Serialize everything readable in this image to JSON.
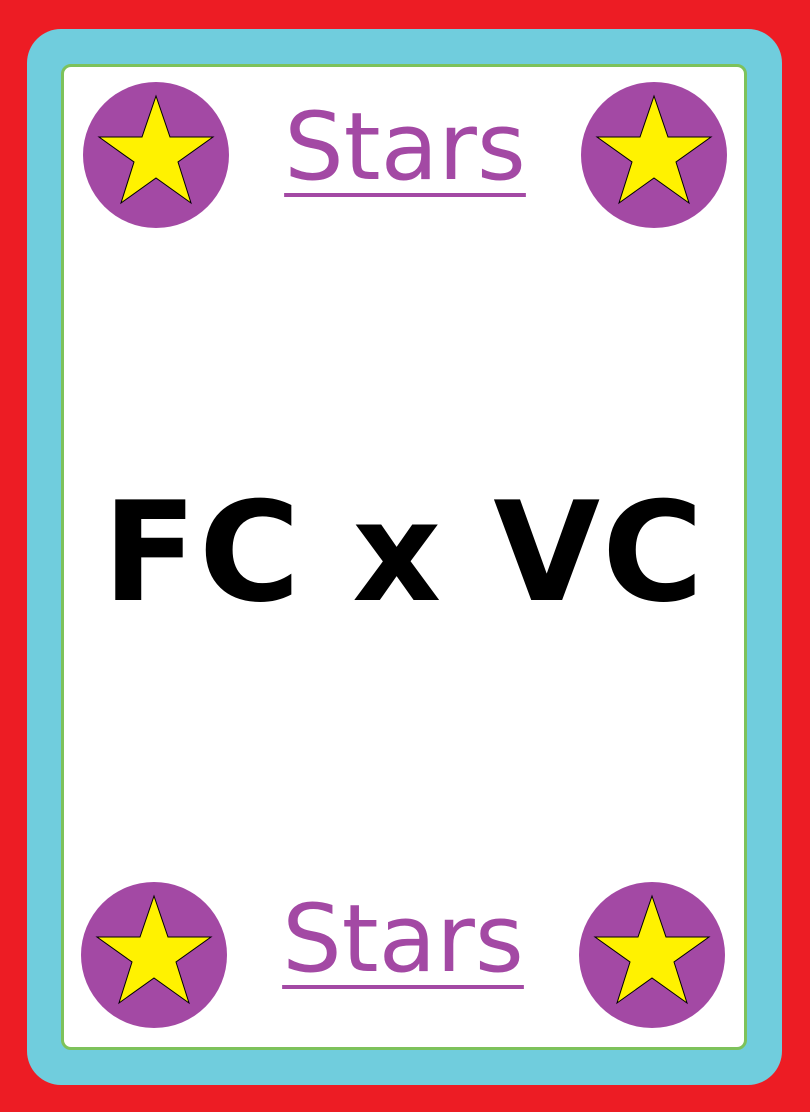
{
  "card": {
    "heading_top": "Stars",
    "heading_bottom": "Stars",
    "title": "FC x VC"
  },
  "icons": {
    "corner_badge": "star-icon"
  },
  "colors": {
    "background": "#ED1C24",
    "frame": "#70CDDD",
    "inner_border": "#7DC25B",
    "badge": "#A349A4",
    "star": "#FFF200",
    "heading": "#A349A4",
    "title": "#000000"
  }
}
